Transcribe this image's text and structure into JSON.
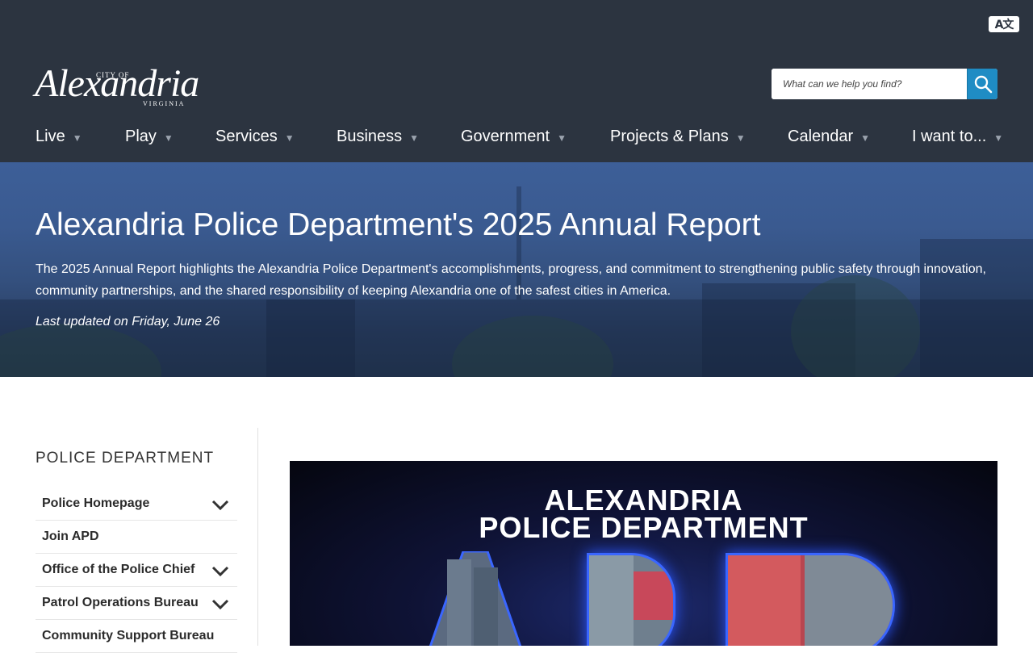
{
  "header": {
    "translate_label": "A文",
    "logo": {
      "city_of": "CITY OF",
      "name": "Alexandria",
      "state": "VIRGINIA"
    },
    "search": {
      "placeholder": "What can we help you find?",
      "icon": "search-icon"
    },
    "nav": [
      {
        "label": "Live"
      },
      {
        "label": "Play"
      },
      {
        "label": "Services"
      },
      {
        "label": "Business"
      },
      {
        "label": "Government"
      },
      {
        "label": "Projects & Plans"
      },
      {
        "label": "Calendar"
      },
      {
        "label": "I want to..."
      }
    ],
    "colors": {
      "header_bg": "#2c3440",
      "search_button": "#1f8cc4"
    }
  },
  "hero": {
    "title": "Alexandria Police Department's 2025 Annual Report",
    "description": "The 2025 Annual Report highlights the Alexandria Police Department's accomplishments, progress, and commitment to strengthening public safety through innovation, community partnerships, and the shared responsibility of keeping Alexandria one of the safest cities in America.",
    "updated": "Last updated on Friday, June 26"
  },
  "sidebar": {
    "title": "POLICE DEPARTMENT",
    "items": [
      {
        "label": "Police Homepage",
        "expandable": true
      },
      {
        "label": "Join APD",
        "expandable": false
      },
      {
        "label": "Office of the Police Chief",
        "expandable": true
      },
      {
        "label": "Patrol Operations Bureau",
        "expandable": true
      },
      {
        "label": "Community Support Bureau",
        "expandable": false
      }
    ]
  },
  "feature": {
    "line1": "ALEXANDRIA",
    "line2": "POLICE DEPARTMENT"
  }
}
